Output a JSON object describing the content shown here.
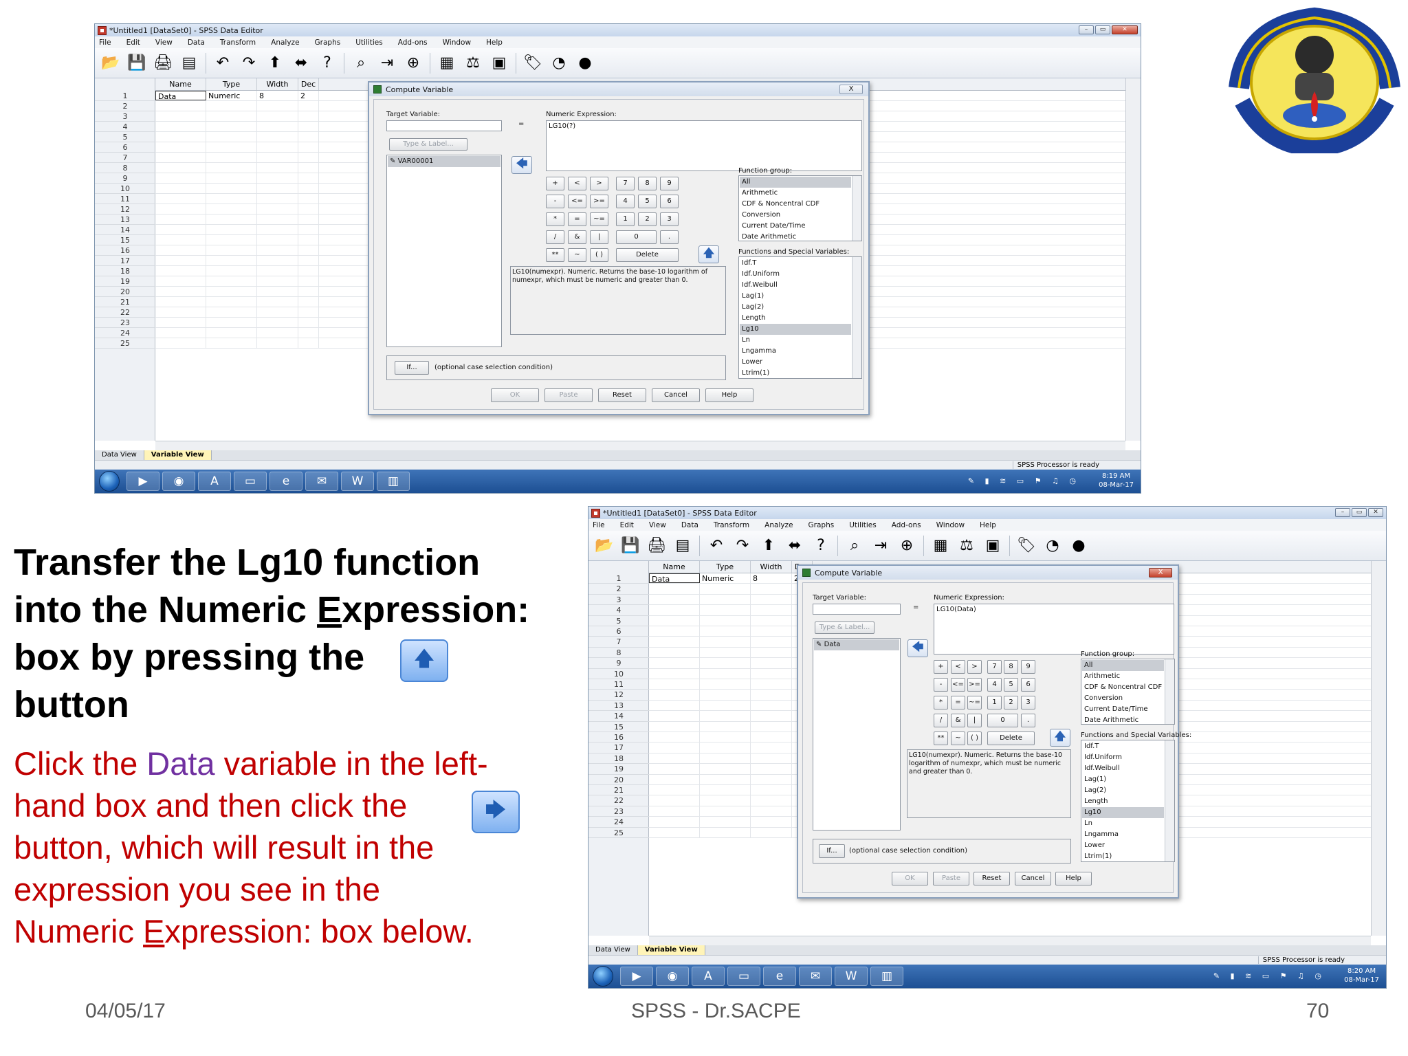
{
  "slide": {
    "heading_line1": "Transfer the Lg10 function",
    "heading_line2_pre": "into the Numeric ",
    "heading_line2_ul": "E",
    "heading_line2_post": "xpression:",
    "heading_line3": "box by pressing the",
    "heading_line4": "button",
    "body_line1_pre": "Click the ",
    "body_line1_highlight": "Data",
    "body_line1_post": " variable in the left-",
    "body_line2": "hand box and then click the",
    "body_line3": "button, which will result in the",
    "body_line4": "expression you see in the",
    "body_line5_pre": "Numeric ",
    "body_line5_ul": "E",
    "body_line5_post": "xpression: box below.",
    "footer_date": "04/05/17",
    "footer_center": "SPSS - Dr.SACPE",
    "footer_page": "70",
    "colors": {
      "heading": "#000000",
      "body": "#c00000",
      "highlight": "#7030a0"
    }
  },
  "spss": {
    "window_title": "*Untitled1 [DataSet0] - SPSS Data Editor",
    "menu": [
      "File",
      "Edit",
      "View",
      "Data",
      "Transform",
      "Analyze",
      "Graphs",
      "Utilities",
      "Add-ons",
      "Window",
      "Help"
    ],
    "columns": [
      "Name",
      "Type",
      "Width",
      "Dec"
    ],
    "row1": {
      "name": "Data",
      "type": "Numeric",
      "width": "8",
      "decimals": "2"
    },
    "row_numbers": [
      "1",
      "2",
      "3",
      "4",
      "5",
      "6",
      "7",
      "8",
      "9",
      "10",
      "11",
      "12",
      "13",
      "14",
      "15",
      "16",
      "17",
      "18",
      "19",
      "20",
      "21",
      "22",
      "23",
      "24",
      "25"
    ],
    "tabs": {
      "data_view": "Data View",
      "variable_view": "Variable View"
    },
    "status": "SPSS Processor is ready",
    "clock_top": {
      "time": "8:19 AM",
      "date": "08-Mar-17"
    },
    "clock_bottom": {
      "time": "8:20 AM",
      "date": "08-Mar-17"
    }
  },
  "dialog": {
    "title": "Compute Variable",
    "close": "X",
    "target_label": "Target Variable:",
    "equals": "=",
    "numeric_label": "Numeric Expression:",
    "expr_top": "LG10(?)",
    "expr_bottom": "LG10(Data)",
    "type_label_button": "Type & Label...",
    "variable_top": "VAR00001",
    "variable_bottom": "Data",
    "function_group_label": "Function group:",
    "function_groups": [
      "All",
      "Arithmetic",
      "CDF & Noncentral CDF",
      "Conversion",
      "Current Date/Time",
      "Date Arithmetic"
    ],
    "functions_label": "Functions and Special Variables:",
    "functions": [
      "Idf.T",
      "Idf.Uniform",
      "Idf.Weibull",
      "Lag(1)",
      "Lag(2)",
      "Length",
      "Lg10",
      "Ln",
      "Lngamma",
      "Lower",
      "Ltrim(1)"
    ],
    "description": "LG10(numexpr). Numeric. Returns the base-10 logarithm of numexpr, which must be numeric and greater than 0.",
    "keypad": [
      [
        "+",
        "<",
        ">",
        "7",
        "8",
        "9"
      ],
      [
        "-",
        "<=",
        ">=",
        "4",
        "5",
        "6"
      ],
      [
        "*",
        "=",
        "~=",
        "1",
        "2",
        "3"
      ],
      [
        "/",
        "&",
        "|",
        "0",
        "."
      ],
      [
        "**",
        "~",
        "( )",
        "Delete"
      ]
    ],
    "if_button": "If...",
    "if_text": "(optional case selection condition)",
    "buttons": [
      "OK",
      "Paste",
      "Reset",
      "Cancel",
      "Help"
    ]
  },
  "icons": {
    "inline_up": "up-arrow-icon",
    "inline_right": "right-arrow-icon"
  }
}
